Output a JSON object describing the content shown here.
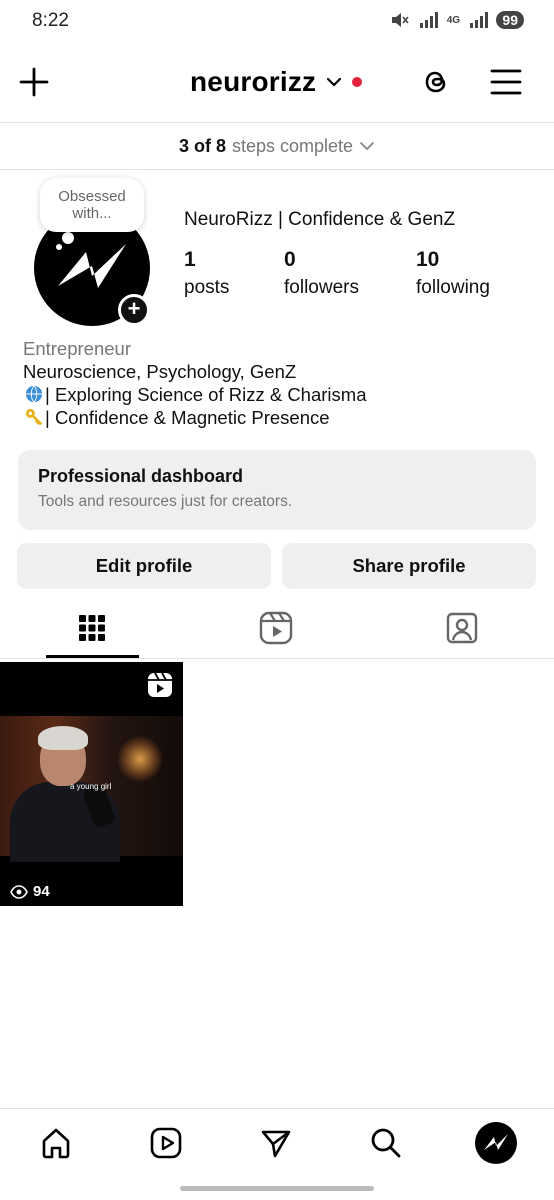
{
  "status_bar": {
    "time": "8:22",
    "network": "4G",
    "battery": "99"
  },
  "header": {
    "username": "neurorizz",
    "icons": [
      "plus-icon",
      "chevron-down-icon",
      "threads-icon",
      "menu-icon"
    ]
  },
  "steps": {
    "count": "3 of 8",
    "label": "steps complete"
  },
  "profile": {
    "note": "Obsessed with...",
    "display_name": "NeuroRizz | Confidence & GenZ",
    "stats": [
      {
        "value": "1",
        "label": "posts"
      },
      {
        "value": "0",
        "label": "followers"
      },
      {
        "value": "10",
        "label": "following"
      }
    ],
    "category": "Entrepreneur",
    "bio_lines": [
      "Neuroscience, Psychology, GenZ",
      "| Exploring Science of Rizz & Charisma",
      "| Confidence & Magnetic Presence"
    ],
    "bio_emojis": [
      "globe-emoji",
      "key-emoji"
    ]
  },
  "dashboard": {
    "title": "Professional dashboard",
    "subtitle": "Tools and resources just for creators."
  },
  "buttons": {
    "edit": "Edit profile",
    "share": "Share profile"
  },
  "tabs": [
    {
      "name": "grid-icon",
      "active": true
    },
    {
      "name": "reels-icon",
      "active": false
    },
    {
      "name": "tagged-icon",
      "active": false
    }
  ],
  "posts": [
    {
      "type": "reel",
      "caption": "a young girl",
      "views": "94"
    }
  ],
  "bottom_nav": [
    "home-icon",
    "reels-icon",
    "send-icon",
    "search-icon",
    "profile-avatar"
  ],
  "colors": {
    "accent_red": "#e6233c",
    "surface": "#efeff1",
    "muted_text": "#777777"
  }
}
